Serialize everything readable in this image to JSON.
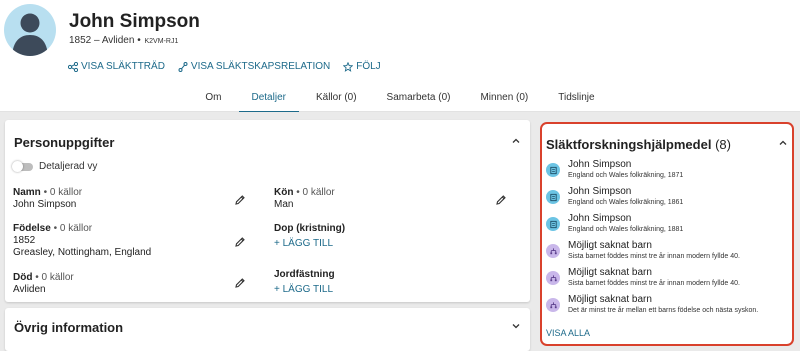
{
  "person": {
    "name": "John Simpson",
    "lifespan": "1852 – Avliden •",
    "pid": "K2VM-RJ1"
  },
  "actions": [
    {
      "label": "Visa släktträd",
      "icon": "tree-icon"
    },
    {
      "label": "Visa släktskapsrelation",
      "icon": "relationship-icon"
    },
    {
      "label": "Följ",
      "icon": "star-icon"
    }
  ],
  "tabs": [
    {
      "label": "Om"
    },
    {
      "label": "Detaljer"
    },
    {
      "label": "Källor (0)"
    },
    {
      "label": "Samarbeta (0)"
    },
    {
      "label": "Minnen (0)"
    },
    {
      "label": "Tidslinje"
    }
  ],
  "active_tab": "Detaljer",
  "personal": {
    "title": "Personuppgifter",
    "toggle_label": "Detaljerad vy",
    "name": {
      "label": "Namn",
      "count": " • 0 källor",
      "value": "John Simpson"
    },
    "birth": {
      "label": "Födelse",
      "count": " • 0 källor",
      "date": "1852",
      "place": "Greasley, Nottingham, England"
    },
    "death": {
      "label": "Död",
      "count": " • 0 källor",
      "value": "Avliden"
    },
    "sex": {
      "label": "Kön",
      "count": " • 0 källor",
      "value": "Man"
    },
    "baptism": {
      "label": "Dop (kristning)",
      "add": "+ Lägg till"
    },
    "burial": {
      "label": "Jordfästning",
      "add": "+ Lägg till"
    }
  },
  "other": {
    "title": "Övrig information"
  },
  "helpers": {
    "title": "Släktforskningshjälpmedel",
    "count": "(8)",
    "items": [
      {
        "type": "record",
        "title": "John Simpson",
        "sub": "England och Wales folkräkning, 1871"
      },
      {
        "type": "record",
        "title": "John Simpson",
        "sub": "England och Wales folkräkning, 1861"
      },
      {
        "type": "record",
        "title": "John Simpson",
        "sub": "England och Wales folkräkning, 1881"
      },
      {
        "type": "child",
        "title": "Möjligt saknat barn",
        "sub": "Sista barnet föddes minst tre år innan modern fyllde 40."
      },
      {
        "type": "child",
        "title": "Möjligt saknat barn",
        "sub": "Sista barnet föddes minst tre år innan modern fyllde 40."
      },
      {
        "type": "child",
        "title": "Möjligt saknat barn",
        "sub": "Det är minst tre år mellan ett barns födelse och nästa syskon."
      }
    ],
    "show_all": "Visa alla"
  },
  "colors": {
    "accent": "#1d6a8a",
    "highlight_border": "#d9412c",
    "record_icon": "#6cc4e4",
    "child_icon": "#c9b7ea"
  }
}
